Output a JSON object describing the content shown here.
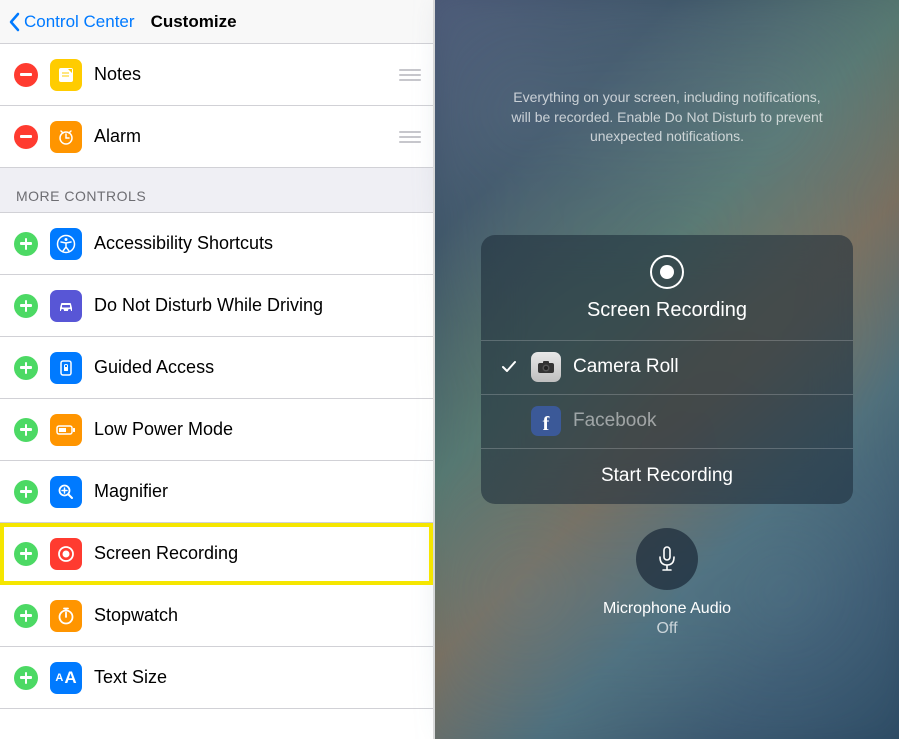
{
  "nav": {
    "back": "Control Center",
    "title": "Customize"
  },
  "included": [
    {
      "label": "Notes",
      "icon": "notes"
    },
    {
      "label": "Alarm",
      "icon": "alarm"
    }
  ],
  "more_header": "MORE CONTROLS",
  "more": [
    {
      "label": "Accessibility Shortcuts",
      "icon": "access",
      "highlight": false
    },
    {
      "label": "Do Not Disturb While Driving",
      "icon": "dnd",
      "highlight": false
    },
    {
      "label": "Guided Access",
      "icon": "guided",
      "highlight": false
    },
    {
      "label": "Low Power Mode",
      "icon": "power",
      "highlight": false
    },
    {
      "label": "Magnifier",
      "icon": "mag",
      "highlight": false
    },
    {
      "label": "Screen Recording",
      "icon": "rec",
      "highlight": true
    },
    {
      "label": "Stopwatch",
      "icon": "stop",
      "highlight": false
    },
    {
      "label": "Text Size",
      "icon": "text",
      "highlight": false
    }
  ],
  "right": {
    "disclaimer": "Everything on your screen, including notifications, will be recorded. Enable Do Not Disturb to prevent unexpected notifications.",
    "title": "Screen Recording",
    "items": {
      "camera_roll": "Camera Roll",
      "facebook": "Facebook"
    },
    "action": "Start Recording",
    "mic_label": "Microphone Audio",
    "mic_status": "Off"
  }
}
